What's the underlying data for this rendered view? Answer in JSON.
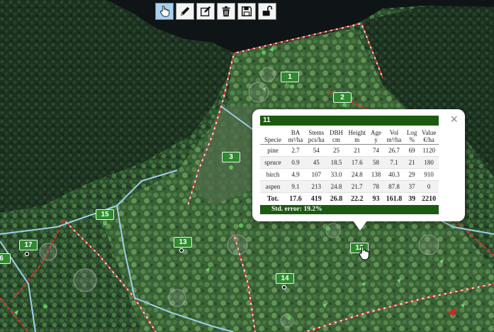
{
  "toolbar": {
    "buttons": [
      {
        "name": "pan-tool",
        "icon": "hand-pointer-icon",
        "active": true
      },
      {
        "name": "edit-tool",
        "icon": "pencil-icon",
        "active": false
      },
      {
        "name": "edit-attributes-tool",
        "icon": "edit-square-icon",
        "active": false
      },
      {
        "name": "delete-tool",
        "icon": "trash-icon",
        "active": false
      },
      {
        "name": "save-tool",
        "icon": "floppy-disk-icon",
        "active": false
      },
      {
        "name": "lock-tool",
        "icon": "unlock-icon",
        "active": false
      }
    ]
  },
  "stands": [
    "1",
    "2",
    "3",
    "13",
    "14",
    "15",
    "17",
    "6",
    "12"
  ],
  "popup": {
    "close_glyph": "×",
    "title": "11",
    "headers": {
      "specie": "Specie",
      "ba": [
        "BA",
        "m²/ha"
      ],
      "stems": [
        "Stems",
        "pcs/ha"
      ],
      "dbh": [
        "DBH",
        "cm"
      ],
      "height": [
        "Height",
        "m"
      ],
      "age": [
        "Age",
        "y"
      ],
      "vol": [
        "Vol",
        "m³/ha"
      ],
      "log": [
        "Log",
        "%"
      ],
      "value": [
        "Value",
        "€/ha"
      ]
    },
    "rows": [
      {
        "specie": "pine",
        "ba": "2.7",
        "stems": "54",
        "dbh": "25",
        "height": "21",
        "age": "74",
        "vol": "26.7",
        "log": "69",
        "value": "1120"
      },
      {
        "specie": "spruce",
        "ba": "0.9",
        "stems": "45",
        "dbh": "18.5",
        "height": "17.6",
        "age": "58",
        "vol": "7.1",
        "log": "21",
        "value": "180"
      },
      {
        "specie": "birch",
        "ba": "4.9",
        "stems": "107",
        "dbh": "33.0",
        "height": "24.8",
        "age": "138",
        "vol": "40.3",
        "log": "29",
        "value": "910"
      },
      {
        "specie": "aspen",
        "ba": "9.1",
        "stems": "213",
        "dbh": "24.8",
        "height": "21.7",
        "age": "78",
        "vol": "87.8",
        "log": "37",
        "value": "0"
      }
    ],
    "total": {
      "specie": "Tot.",
      "ba": "17.6",
      "stems": "419",
      "dbh": "26.8",
      "height": "22.2",
      "age": "93",
      "vol": "161.8",
      "log": "39",
      "value": "2210"
    },
    "footer": "Std. error: 19.2%"
  },
  "colors": {
    "stand_label_bg": "#2f8a2f",
    "popup_header_bg": "#1c5a12",
    "boundary_red": "#e03030",
    "boundary_blue": "#9fd0e8"
  }
}
